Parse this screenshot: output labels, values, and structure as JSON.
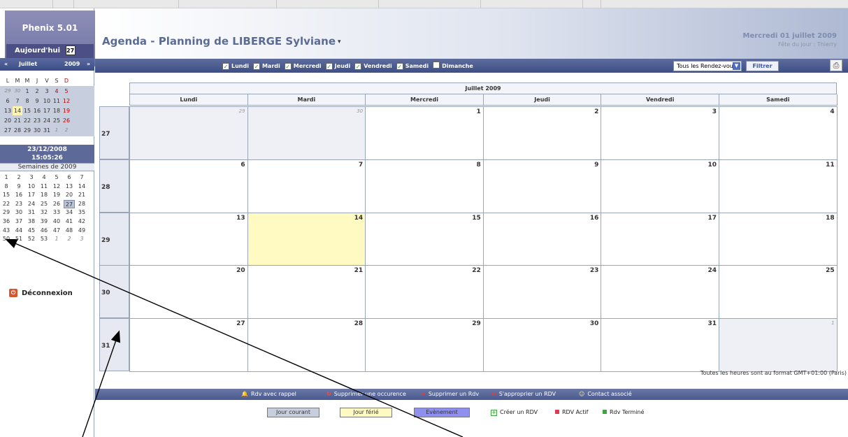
{
  "app": {
    "name": "Phenix 5.01",
    "today_label": "Aujourd'hui",
    "today_icon_text": "27",
    "logout_label": "Déconnexion"
  },
  "minical": {
    "prev": "«",
    "month": "Juillet",
    "year": "2009",
    "next": "»",
    "dow": [
      "L",
      "M",
      "M",
      "J",
      "V",
      "S",
      "D"
    ],
    "rows": [
      [
        "29",
        "30",
        "1",
        "2",
        "3",
        "4",
        "5"
      ],
      [
        "6",
        "7",
        "8",
        "9",
        "10",
        "11",
        "12"
      ],
      [
        "13",
        "14",
        "15",
        "16",
        "17",
        "18",
        "19"
      ],
      [
        "20",
        "21",
        "22",
        "23",
        "24",
        "25",
        "26"
      ],
      [
        "27",
        "28",
        "29",
        "30",
        "31",
        "1",
        "2"
      ]
    ],
    "clock_date": "23/12/2008",
    "clock_time": "15:05:26",
    "weeks_title": "Semaines de 2009",
    "weeks": [
      [
        "1",
        "2",
        "3",
        "4",
        "5",
        "6",
        "7"
      ],
      [
        "8",
        "9",
        "10",
        "11",
        "12",
        "13",
        "14"
      ],
      [
        "15",
        "16",
        "17",
        "18",
        "19",
        "20",
        "21"
      ],
      [
        "22",
        "23",
        "24",
        "25",
        "26",
        "27",
        "28"
      ],
      [
        "29",
        "30",
        "31",
        "32",
        "33",
        "34",
        "35"
      ],
      [
        "36",
        "37",
        "38",
        "39",
        "40",
        "41",
        "42"
      ],
      [
        "43",
        "44",
        "45",
        "46",
        "47",
        "48",
        "49"
      ],
      [
        "50",
        "51",
        "52",
        "53",
        "1",
        "2",
        "3"
      ]
    ]
  },
  "header": {
    "title": "Agenda - Planning de LIBERGE Sylviane",
    "caret": "▾",
    "date": "Mercredi 01 juillet 2009",
    "fete": "Fête du jour : Thierry"
  },
  "toolbar": {
    "days": [
      {
        "label": "Lundi",
        "checked": true
      },
      {
        "label": "Mardi",
        "checked": true
      },
      {
        "label": "Mercredi",
        "checked": true
      },
      {
        "label": "Jeudi",
        "checked": true
      },
      {
        "label": "Vendredi",
        "checked": true
      },
      {
        "label": "Samedi",
        "checked": true
      },
      {
        "label": "Dimanche",
        "checked": false
      }
    ],
    "select_value": "Tous les Rendez-vous",
    "filter_label": "Filtrer"
  },
  "calendar": {
    "month_title": "Juillet 2009",
    "day_headers": [
      "Lundi",
      "Mardi",
      "Mercredi",
      "Jeudi",
      "Vendredi",
      "Samedi"
    ],
    "weeks": [
      {
        "num": "27",
        "days": [
          "29",
          "30",
          "1",
          "2",
          "3",
          "4"
        ]
      },
      {
        "num": "28",
        "days": [
          "6",
          "7",
          "8",
          "9",
          "10",
          "11"
        ]
      },
      {
        "num": "29",
        "days": [
          "13",
          "14",
          "15",
          "16",
          "17",
          "18"
        ]
      },
      {
        "num": "30",
        "days": [
          "20",
          "21",
          "22",
          "23",
          "24",
          "25"
        ]
      },
      {
        "num": "31",
        "days": [
          "27",
          "28",
          "29",
          "30",
          "31",
          "1"
        ]
      }
    ],
    "timezone_note": "Toutes les heures sont au format GMT+01:00 (Paris)"
  },
  "legend": {
    "items": [
      "Rdv avec rappel",
      "Supprimer une occurence",
      "Supprimer un Rdv",
      "S'approprier un RDV",
      "Contact associé"
    ],
    "swatches": [
      "Jour courant",
      "Jour férié",
      "Evènement"
    ],
    "create": "Créer un RDV",
    "actif": "RDV Actif",
    "termine": "Rdv Terminé"
  },
  "colors": {
    "accent": "#3e4f86",
    "holiday": "#fff9c2",
    "current_day": "#c7cedd",
    "event": "#8f8ff0"
  }
}
